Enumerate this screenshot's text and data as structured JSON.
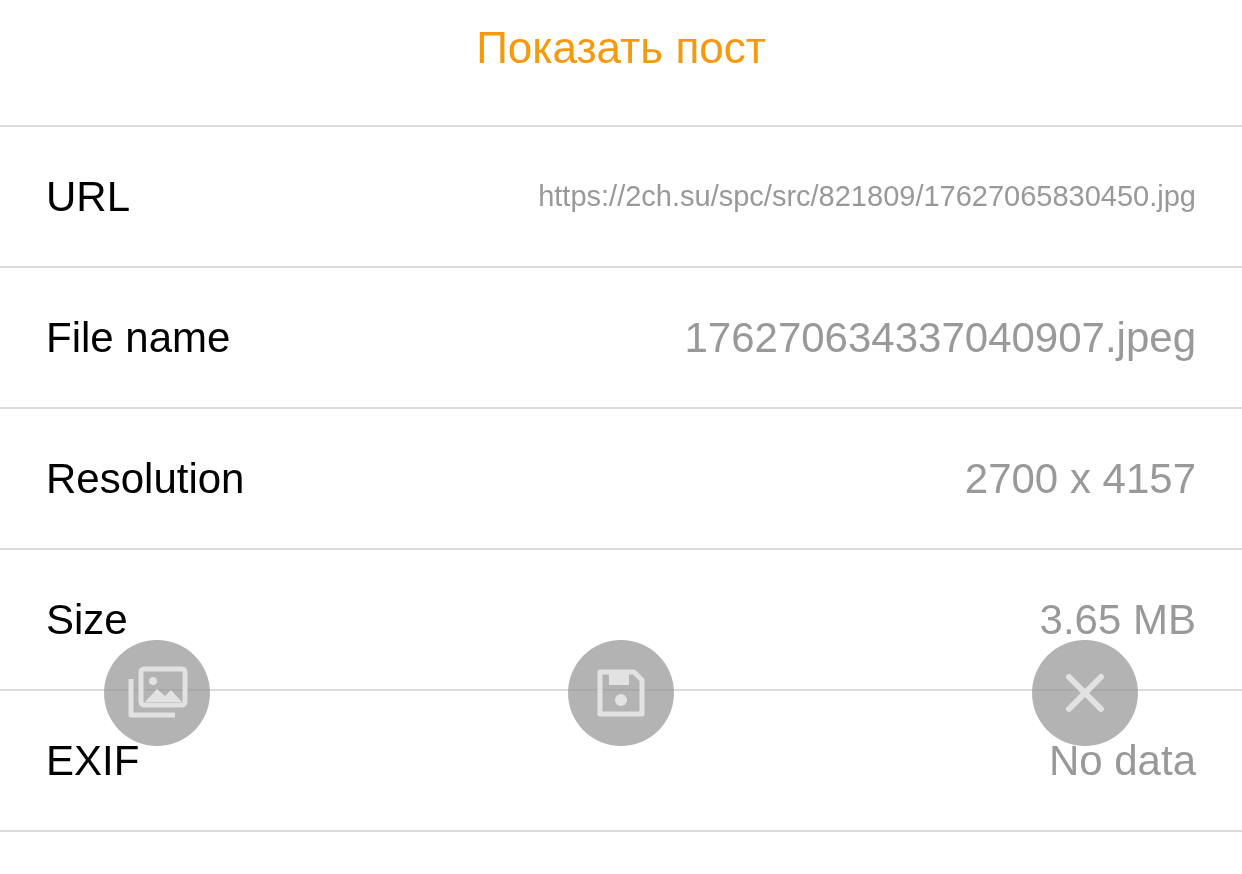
{
  "header": {
    "title": "Показать пост"
  },
  "rows": [
    {
      "label": "URL",
      "value": "https://2ch.su/spc/src/821809/17627065830450.jpg",
      "kind": "url"
    },
    {
      "label": "File name",
      "value": "176270634337040907.jpeg",
      "kind": "plain"
    },
    {
      "label": "Resolution",
      "value": "2700 x 4157",
      "kind": "plain"
    },
    {
      "label": "Size",
      "value": "3.65 MB",
      "kind": "plain"
    },
    {
      "label": "EXIF",
      "value": "No data",
      "kind": "plain"
    }
  ],
  "actions": [
    {
      "kind": "gallery"
    },
    {
      "kind": "save"
    },
    {
      "kind": "close"
    }
  ]
}
